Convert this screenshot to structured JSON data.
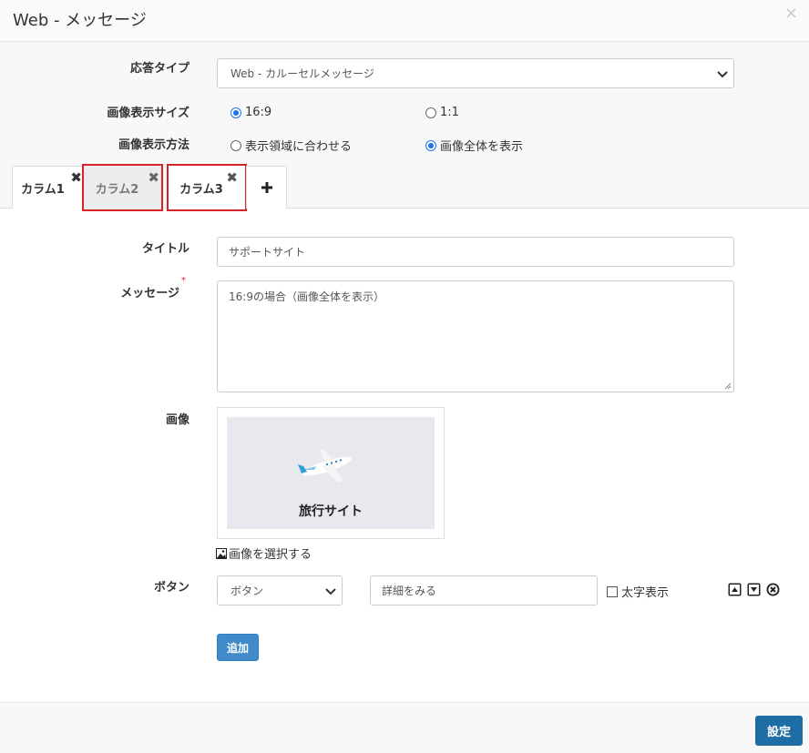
{
  "header": {
    "title": "Web - メッセージ",
    "close": "×"
  },
  "settings": {
    "response_type_label": "応答タイプ",
    "response_type_value": "Web - カルーセルメッセージ",
    "image_size_label": "画像表示サイズ",
    "image_size_options": [
      "16:9",
      "1:1"
    ],
    "image_size_selected": "16:9",
    "image_display_label": "画像表示方法",
    "image_display_options": [
      "表示領域に合わせる",
      "画像全体を表示"
    ],
    "image_display_selected": "画像全体を表示"
  },
  "tabs": [
    {
      "label": "カラム1",
      "close": "✖"
    },
    {
      "label": "カラム2",
      "close": "✖"
    },
    {
      "label": "カラム3",
      "close": "✖"
    }
  ],
  "add_tab": "+",
  "form": {
    "title_label": "タイトル",
    "title_value": "サポートサイト",
    "message_label": "メッセージ",
    "message_required": "*",
    "message_value": "16:9の場合（画像全体を表示）",
    "image_label": "画像",
    "image_caption": "旅行サイト",
    "select_image": "画像を選択する",
    "button_label": "ボタン",
    "button_type_value": "ボタン",
    "button_text_value": "詳細をみる",
    "bold_label": "太字表示",
    "add_button": "追加"
  },
  "footer": {
    "submit": "設定"
  },
  "colors": {
    "primary": "#428bca",
    "submit": "#1e6da5",
    "highlight": "#d82428",
    "radio": "#1a73e8"
  }
}
